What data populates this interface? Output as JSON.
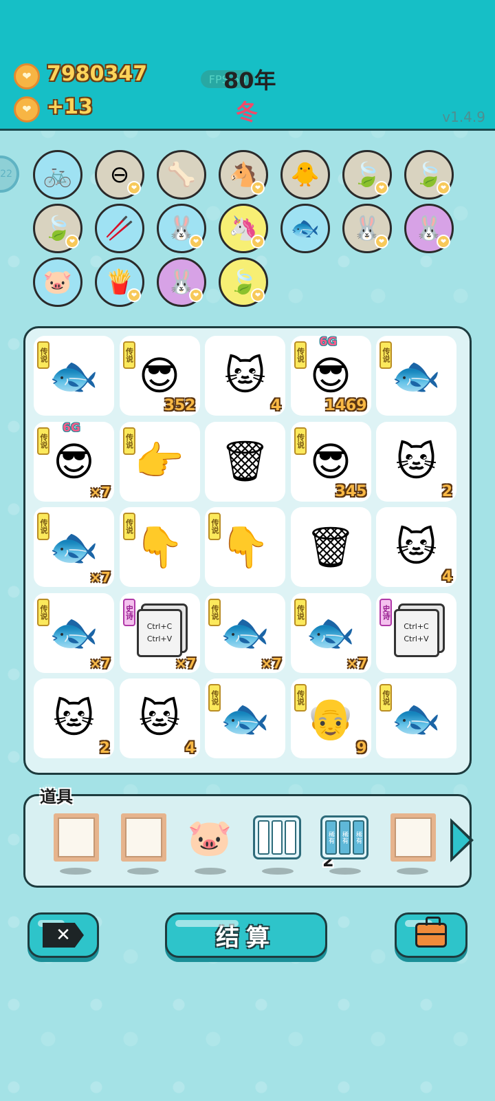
{
  "header": {
    "coins": "7980347",
    "income": "+13",
    "fps": "FPS 60",
    "year": "80年",
    "season": "冬",
    "version": "v1.4.9",
    "side_timer": "22"
  },
  "symbols": [
    {
      "icon": "🚲",
      "name": "pump",
      "bg": "c-blue",
      "coin": false
    },
    {
      "icon": "⊖",
      "name": "minus",
      "bg": "c-tan",
      "coin": true
    },
    {
      "icon": "🦴",
      "name": "dog-food",
      "bg": "c-tan",
      "coin": false
    },
    {
      "icon": "🐴",
      "name": "horses",
      "bg": "c-tan",
      "coin": true
    },
    {
      "icon": "🐥",
      "name": "chick",
      "bg": "c-tan",
      "coin": false
    },
    {
      "icon": "🍃",
      "name": "leaf",
      "bg": "c-tan",
      "coin": true
    },
    {
      "icon": "🍃",
      "name": "leaf",
      "bg": "c-tan",
      "coin": true
    },
    {
      "icon": "🍃",
      "name": "leaf",
      "bg": "c-tan",
      "coin": true
    },
    {
      "icon": "🥢",
      "name": "chopsticks",
      "bg": "c-blue",
      "coin": false
    },
    {
      "icon": "🐰",
      "name": "rabbit",
      "bg": "c-blue",
      "coin": true
    },
    {
      "icon": "🦄",
      "name": "unicorn",
      "bg": "c-yellow",
      "coin": true
    },
    {
      "icon": "🐟",
      "name": "fish-bowl",
      "bg": "c-blue",
      "coin": false
    },
    {
      "icon": "🐰",
      "name": "rabbit",
      "bg": "c-tan",
      "coin": true
    },
    {
      "icon": "🐰",
      "name": "rabbit",
      "bg": "c-purple",
      "coin": true
    },
    {
      "icon": "🐷",
      "name": "piggy-bank",
      "bg": "c-blue",
      "coin": false
    },
    {
      "icon": "🍟",
      "name": "fries",
      "bg": "c-blue",
      "coin": true
    },
    {
      "icon": "🐰",
      "name": "rabbit",
      "bg": "c-purple",
      "coin": true
    },
    {
      "icon": "🍃",
      "name": "leaf",
      "bg": "c-yellow",
      "coin": true
    }
  ],
  "tag_legend": "传说",
  "tag_epic": "史诗",
  "badge": "6G",
  "ctrl_lines": [
    "Ctrl+C",
    "Ctrl+V"
  ],
  "board": [
    {
      "icon": "🐟",
      "name": "koi",
      "tag": "legend",
      "count": ""
    },
    {
      "icon": "😎",
      "name": "psy",
      "tag": "legend",
      "count": "352"
    },
    {
      "icon": "🐱",
      "name": "cat",
      "tag": "",
      "count": "4"
    },
    {
      "icon": "😎",
      "name": "psy",
      "tag": "legend",
      "count": "1469",
      "badge": true
    },
    {
      "icon": "🐟",
      "name": "koi",
      "tag": "legend",
      "count": ""
    },
    {
      "icon": "😎",
      "name": "psy",
      "tag": "legend",
      "count": "×7",
      "badge": true
    },
    {
      "icon": "👉",
      "name": "pointing-hand",
      "tag": "legend",
      "count": ""
    },
    {
      "icon": "🗑",
      "name": "garbage-bag",
      "tag": "",
      "count": ""
    },
    {
      "icon": "😎",
      "name": "psy",
      "tag": "legend",
      "count": "345"
    },
    {
      "icon": "🐱",
      "name": "cat",
      "tag": "",
      "count": "2"
    },
    {
      "icon": "🐟",
      "name": "koi",
      "tag": "legend",
      "count": "×7"
    },
    {
      "icon": "👇",
      "name": "pointing-hand",
      "tag": "legend",
      "count": ""
    },
    {
      "icon": "👇",
      "name": "pointing-hand",
      "tag": "legend",
      "count": ""
    },
    {
      "icon": "🗑",
      "name": "garbage-bag",
      "tag": "",
      "count": ""
    },
    {
      "icon": "🐱",
      "name": "cat",
      "tag": "",
      "count": "4"
    },
    {
      "icon": "🐟",
      "name": "koi",
      "tag": "legend",
      "count": "×7"
    },
    {
      "icon": "ctrl",
      "name": "ctrl-cv",
      "tag": "epic",
      "count": "×7"
    },
    {
      "icon": "🐟",
      "name": "koi",
      "tag": "legend",
      "count": "×7"
    },
    {
      "icon": "🐟",
      "name": "koi",
      "tag": "legend",
      "count": "×7"
    },
    {
      "icon": "ctrl",
      "name": "ctrl-cv",
      "tag": "epic",
      "count": ""
    },
    {
      "icon": "🐱",
      "name": "cat",
      "tag": "",
      "count": "2"
    },
    {
      "icon": "🐱",
      "name": "cat",
      "tag": "",
      "count": "4"
    },
    {
      "icon": "🐟",
      "name": "koi",
      "tag": "legend",
      "count": ""
    },
    {
      "icon": "👴",
      "name": "old-man",
      "tag": "legend",
      "count": "9"
    },
    {
      "icon": "🐟",
      "name": "koi",
      "tag": "legend",
      "count": ""
    }
  ],
  "props": {
    "label": "道具",
    "cabinet_count": "2",
    "cabinet_label": "稀有"
  },
  "buttons": {
    "close": "✕",
    "settle": "结算"
  }
}
